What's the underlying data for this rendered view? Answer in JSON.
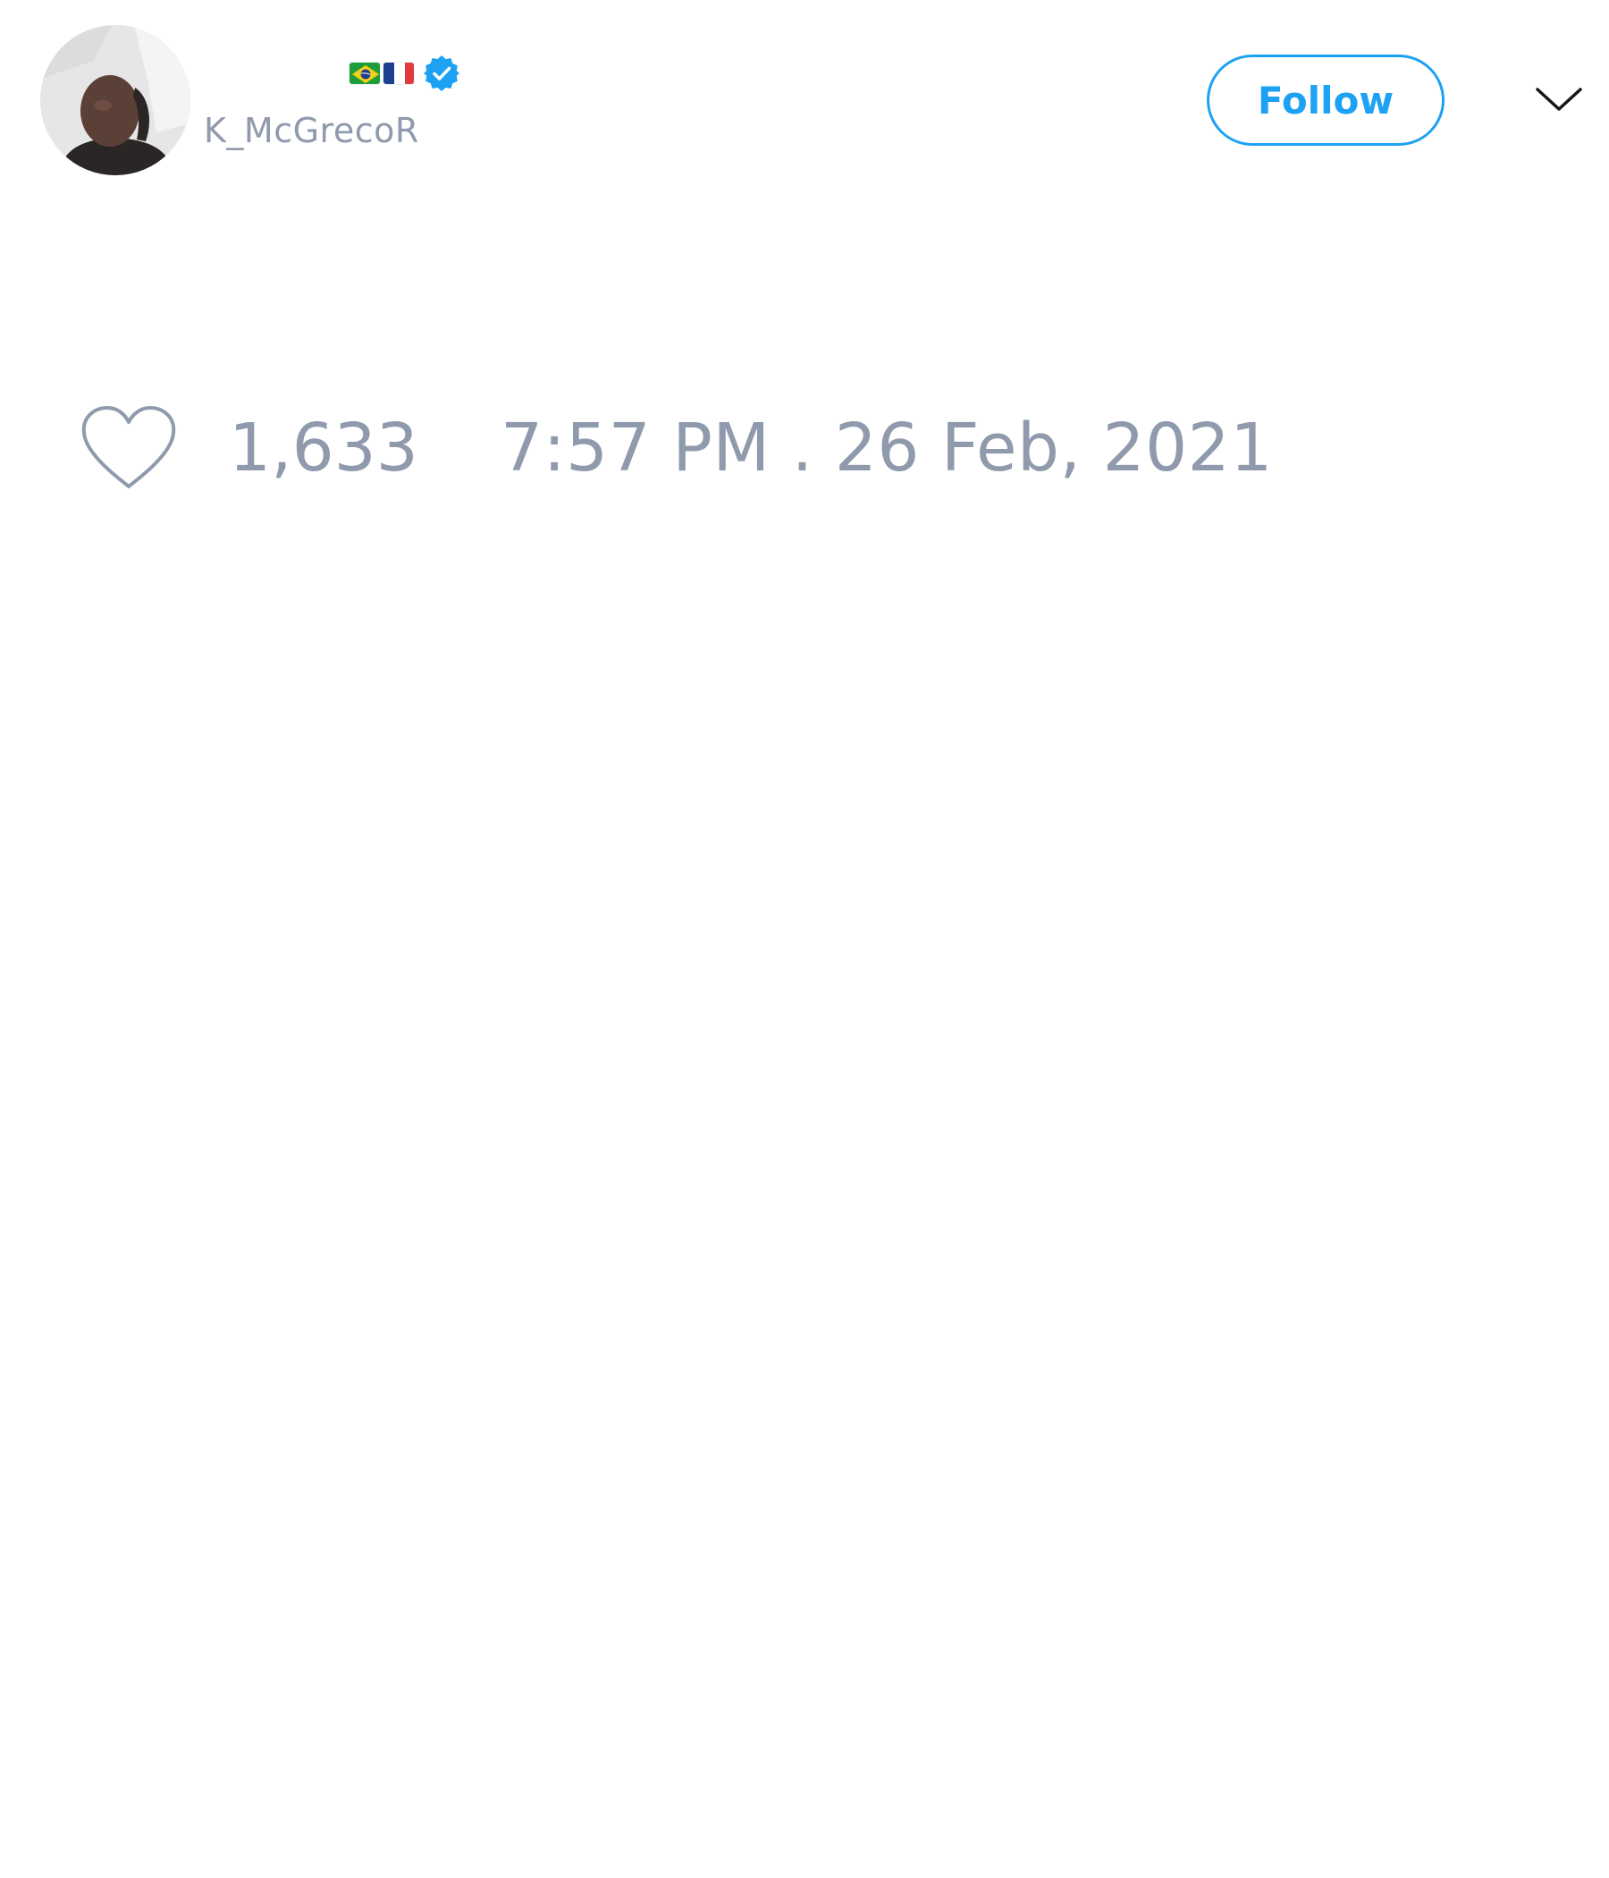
{
  "author": {
    "display_name": "",
    "handle": "K_McGrecoR",
    "flags": [
      "brazil-flag",
      "france-flag"
    ],
    "verified": true,
    "avatar_icon": "profile-photo"
  },
  "actions": {
    "follow_label": "Follow",
    "menu_icon": "chevron-down-icon"
  },
  "stats": {
    "like_icon": "heart-icon",
    "like_count": "1,633",
    "timestamp": "7:57 PM . 26 Feb, 2021"
  },
  "colors": {
    "accent": "#1da1f2",
    "muted_text": "#8f9aad",
    "background": "#ffffff"
  }
}
